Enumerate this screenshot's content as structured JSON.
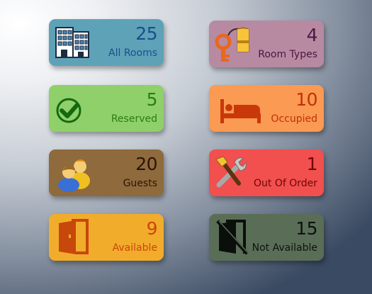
{
  "tiles": [
    {
      "id": "all_rooms",
      "count": "25",
      "label": "All Rooms",
      "icon": "building-icon",
      "color": "#5ea2b8"
    },
    {
      "id": "room_types",
      "count": "4",
      "label": "Room Types",
      "icon": "key-tag-icon",
      "color": "#b78aa2"
    },
    {
      "id": "reserved",
      "count": "5",
      "label": "Reserved",
      "icon": "checkmark-icon",
      "color": "#8fd06a"
    },
    {
      "id": "occupied",
      "count": "10",
      "label": "Occupied",
      "icon": "bed-icon",
      "color": "#fb9a52"
    },
    {
      "id": "guests",
      "count": "20",
      "label": "Guests",
      "icon": "users-icon",
      "color": "#8f6a3c"
    },
    {
      "id": "out_of_order",
      "count": "1",
      "label": "Out Of Order",
      "icon": "tools-icon",
      "color": "#f24f4f"
    },
    {
      "id": "available",
      "count": "9",
      "label": "Available",
      "icon": "open-door-icon",
      "color": "#f2ac2c"
    },
    {
      "id": "not_available",
      "count": "15",
      "label": "Not Available",
      "icon": "door-crossed-icon",
      "color": "#5a6e57"
    }
  ]
}
